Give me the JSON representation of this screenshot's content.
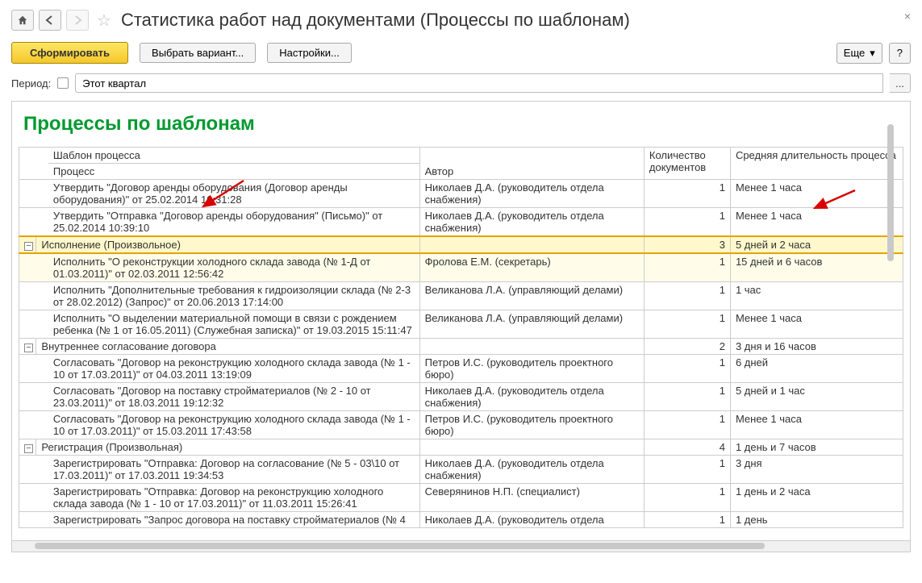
{
  "header": {
    "page_title": "Статистика работ над документами (Процессы по шаблонам)"
  },
  "toolbar": {
    "generate": "Сформировать",
    "choose_variant": "Выбрать вариант...",
    "settings": "Настройки...",
    "more": "Еще",
    "help": "?"
  },
  "period": {
    "label": "Период:",
    "value": "Этот квартал",
    "ellipsis": "..."
  },
  "report": {
    "title": "Процессы по шаблонам",
    "headers": {
      "template": "Шаблон процесса",
      "process": "Процесс",
      "author": "Автор",
      "count": "Количество документов",
      "duration": "Средняя длительность процесса"
    },
    "rows": [
      {
        "type": "child",
        "process": "Утвердить \"Договор аренды оборудования (Договор аренды оборудования)\" от 25.02.2014 10:31:28",
        "author": "Николаев Д.А. (руководитель отдела снабжения)",
        "count": "1",
        "duration": "Менее 1 часа"
      },
      {
        "type": "child",
        "process": "Утвердить \"Отправка \"Договор аренды оборудования\" (Письмо)\" от 25.02.2014 10:39:10",
        "author": "Николаев Д.А. (руководитель отдела снабжения)",
        "count": "1",
        "duration": "Менее 1 часа"
      },
      {
        "type": "group",
        "process": "Исполнение (Произвольное)",
        "author": "",
        "count": "3",
        "duration": "5 дней и 2 часа",
        "highlight": "strong"
      },
      {
        "type": "child",
        "process": "Исполнить \"О реконструкции холодного склада завода (№ 1-Д от 01.03.2011)\" от 02.03.2011 12:56:42",
        "author": "Фролова Е.М. (секретарь)",
        "count": "1",
        "duration": "15 дней и 6 часов",
        "highlight": "soft"
      },
      {
        "type": "child",
        "process": "Исполнить \"Дополнительные требования к гидроизоляции склада (№ 2-3 от 28.02.2012) (Запрос)\" от 20.06.2013 17:14:00",
        "author": "Великанова Л.А. (управляющий делами)",
        "count": "1",
        "duration": "1 час"
      },
      {
        "type": "child",
        "process": "Исполнить \"О выделении материальной помощи в связи с рождением ребенка (№ 1 от 16.05.2011) (Служебная записка)\" от 19.03.2015 15:11:47",
        "author": "Великанова Л.А. (управляющий делами)",
        "count": "1",
        "duration": "Менее 1 часа"
      },
      {
        "type": "group",
        "process": "Внутреннее согласование договора",
        "author": "",
        "count": "2",
        "duration": "3 дня и 16 часов"
      },
      {
        "type": "child",
        "process": "Согласовать \"Договор на реконструкцию холодного склада завода (№ 1 - 10 от 17.03.2011)\" от 04.03.2011 13:19:09",
        "author": "Петров И.С. (руководитель проектного бюро)",
        "count": "1",
        "duration": "6 дней"
      },
      {
        "type": "child",
        "process": "Согласовать \"Договор на поставку стройматериалов (№ 2 - 10 от 23.03.2011)\" от 18.03.2011 19:12:32",
        "author": "Николаев Д.А. (руководитель отдела снабжения)",
        "count": "1",
        "duration": "5 дней и 1 час"
      },
      {
        "type": "child",
        "process": "Согласовать \"Договор на реконструкцию холодного склада завода (№ 1 - 10 от 17.03.2011)\" от 15.03.2011 17:43:58",
        "author": "Петров И.С. (руководитель проектного бюро)",
        "count": "1",
        "duration": "Менее 1 часа"
      },
      {
        "type": "group",
        "process": "Регистрация (Произвольная)",
        "author": "",
        "count": "4",
        "duration": "1 день и 7 часов"
      },
      {
        "type": "child",
        "process": "Зарегистрировать \"Отправка: Договор на согласование (№ 5 - 03\\10 от 17.03.2011)\" от 17.03.2011 19:34:53",
        "author": "Николаев Д.А. (руководитель отдела снабжения)",
        "count": "1",
        "duration": "3 дня"
      },
      {
        "type": "child",
        "process": "Зарегистрировать \"Отправка: Договор на реконструкцию холодного склада завода (№ 1 - 10 от 17.03.2011)\" от 11.03.2011 15:26:41",
        "author": "Северянинов Н.П. (специалист)",
        "count": "1",
        "duration": "1 день и 2 часа"
      },
      {
        "type": "child",
        "process": "Зарегистрировать \"Запрос договора на поставку стройматериалов (№ 4",
        "author": "Николаев Д.А. (руководитель отдела",
        "count": "1",
        "duration": "1 день"
      }
    ]
  },
  "icons": {
    "minus": "−",
    "dropdown": "▾"
  }
}
